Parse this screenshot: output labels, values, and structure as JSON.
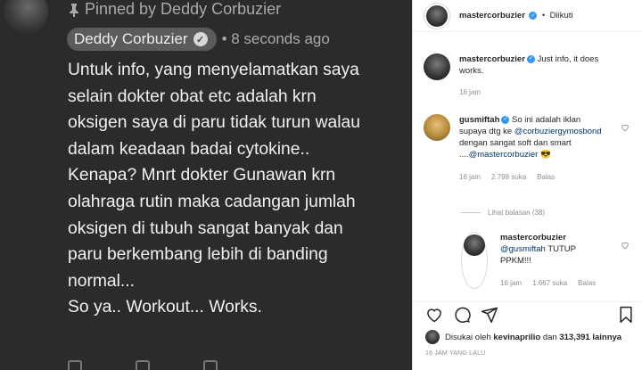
{
  "youtube_comment": {
    "pinned_label": "Pinned by Deddy Corbuzier",
    "author": "Deddy Corbuzier",
    "time": "• 8 seconds ago",
    "lines": [
      "Untuk info, yang menyelamatkan saya",
      "selain dokter obat etc adalah krn",
      "oksigen saya di paru tidak turun walau",
      "dalam keadaan badai cytokine..",
      "Kenapa? Mnrt dokter Gunawan krn",
      "olahraga rutin maka cadangan jumlah",
      "oksigen di tubuh sangat banyak dan",
      "paru berkembang lebih di banding",
      "normal...",
      "So ya.. Workout... Works."
    ]
  },
  "instagram": {
    "header": {
      "username": "mastercorbuzier",
      "separator": "•",
      "follow_status": "Diikuti"
    },
    "caption": {
      "username": "mastercorbuzier",
      "text": "Just info, it does works.",
      "time": "16 jam"
    },
    "comment1": {
      "username": "gusmiftah",
      "text_1": "So ini adalah iklan supaya dtg ke",
      "mention_1": "@corbuziergymosbond",
      "text_2": "dengan sangat soft dan smart ....",
      "mention_2": "@mastercorbuzier",
      "emoji": "😎",
      "time": "16 jam",
      "likes": "2.798 suka",
      "reply": "Balas"
    },
    "view_replies": "Lihat balasan (38)",
    "reply1": {
      "username": "mastercorbuzier",
      "mention": "@gusmiftah",
      "text": "TUTUP PPKM!!!",
      "time": "16 jam",
      "likes": "1.667 suka",
      "reply": "Balas"
    },
    "likes_line": {
      "prefix": "Disukai oleh",
      "user": "kevinaprilio",
      "connector": "dan",
      "count": "313,391 lainnya"
    },
    "posted": "16 JAM YANG LALU"
  }
}
